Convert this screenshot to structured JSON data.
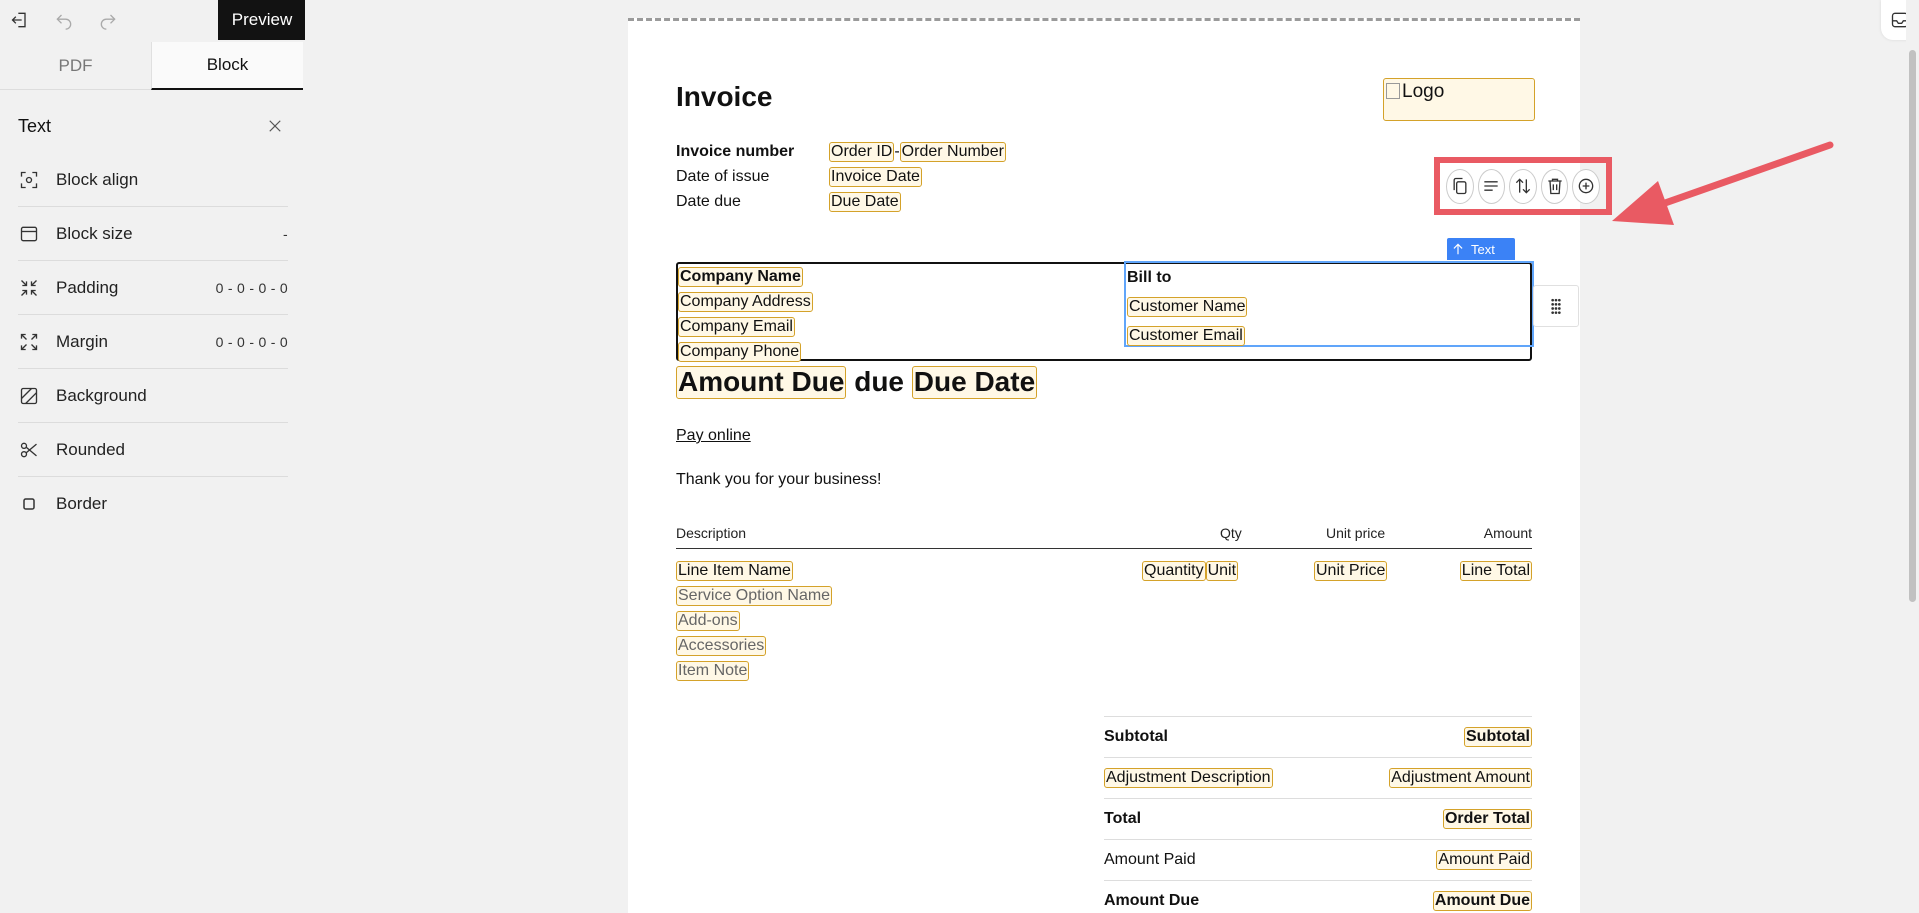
{
  "toolbar": {
    "preview_label": "Preview"
  },
  "tabs": [
    {
      "label": "PDF"
    },
    {
      "label": "Block"
    }
  ],
  "panel": {
    "title": "Text",
    "properties": [
      {
        "label": "Block align",
        "value": "",
        "icon": "block-align-icon"
      },
      {
        "label": "Block size",
        "value": "-",
        "icon": "block-size-icon"
      },
      {
        "label": "Padding",
        "value": "0 - 0 - 0 - 0",
        "icon": "padding-icon"
      },
      {
        "label": "Margin",
        "value": "0 - 0 - 0 - 0",
        "icon": "margin-icon"
      },
      {
        "label": "Background",
        "value": "",
        "icon": "background-icon"
      },
      {
        "label": "Rounded",
        "value": "",
        "icon": "rounded-icon"
      },
      {
        "label": "Border",
        "value": "",
        "icon": "border-icon"
      }
    ]
  },
  "invoice": {
    "title": "Invoice",
    "logo_alt": "Logo",
    "meta": {
      "number_label": "Invoice number",
      "order_id": "Order ID",
      "dash": "-",
      "order_number": "Order Number",
      "issue_label": "Date of issue",
      "invoice_date": "Invoice Date",
      "due_label": "Date due",
      "due_date": "Due Date"
    },
    "company": {
      "name": "Company Name",
      "address": "Company Address",
      "email": "Company Email",
      "phone": "Company Phone"
    },
    "bill_to": {
      "title": "Bill to",
      "customer_name": "Customer Name",
      "customer_email": "Customer Email"
    },
    "block_badge": "Text",
    "amount_due_line": {
      "amount": "Amount Due",
      "due": "due",
      "date": "Due Date"
    },
    "pay_online": "Pay online",
    "thanks": "Thank you for your business!",
    "items_header": {
      "description": "Description",
      "qty": "Qty",
      "unit_price": "Unit price",
      "amount": "Amount"
    },
    "item": {
      "name": "Line Item Name",
      "quantity": "Quantity",
      "unit": "Unit",
      "unit_price": "Unit Price",
      "line_total": "Line Total",
      "service_option": "Service Option Name",
      "addons": "Add-ons",
      "accessories": "Accessories",
      "note": "Item Note"
    },
    "totals": {
      "subtotal_label": "Subtotal",
      "subtotal_value": "Subtotal",
      "adjustment_label": "Adjustment Description",
      "adjustment_value": "Adjustment Amount",
      "total_label": "Total",
      "total_value": "Order Total",
      "paid_label": "Amount Paid",
      "paid_value": "Amount Paid",
      "due_label": "Amount Due",
      "due_value": "Amount Due"
    }
  },
  "colors": {
    "token_border": "#d4a22a",
    "highlight": "#e95a63",
    "selection": "#3b82f6"
  }
}
